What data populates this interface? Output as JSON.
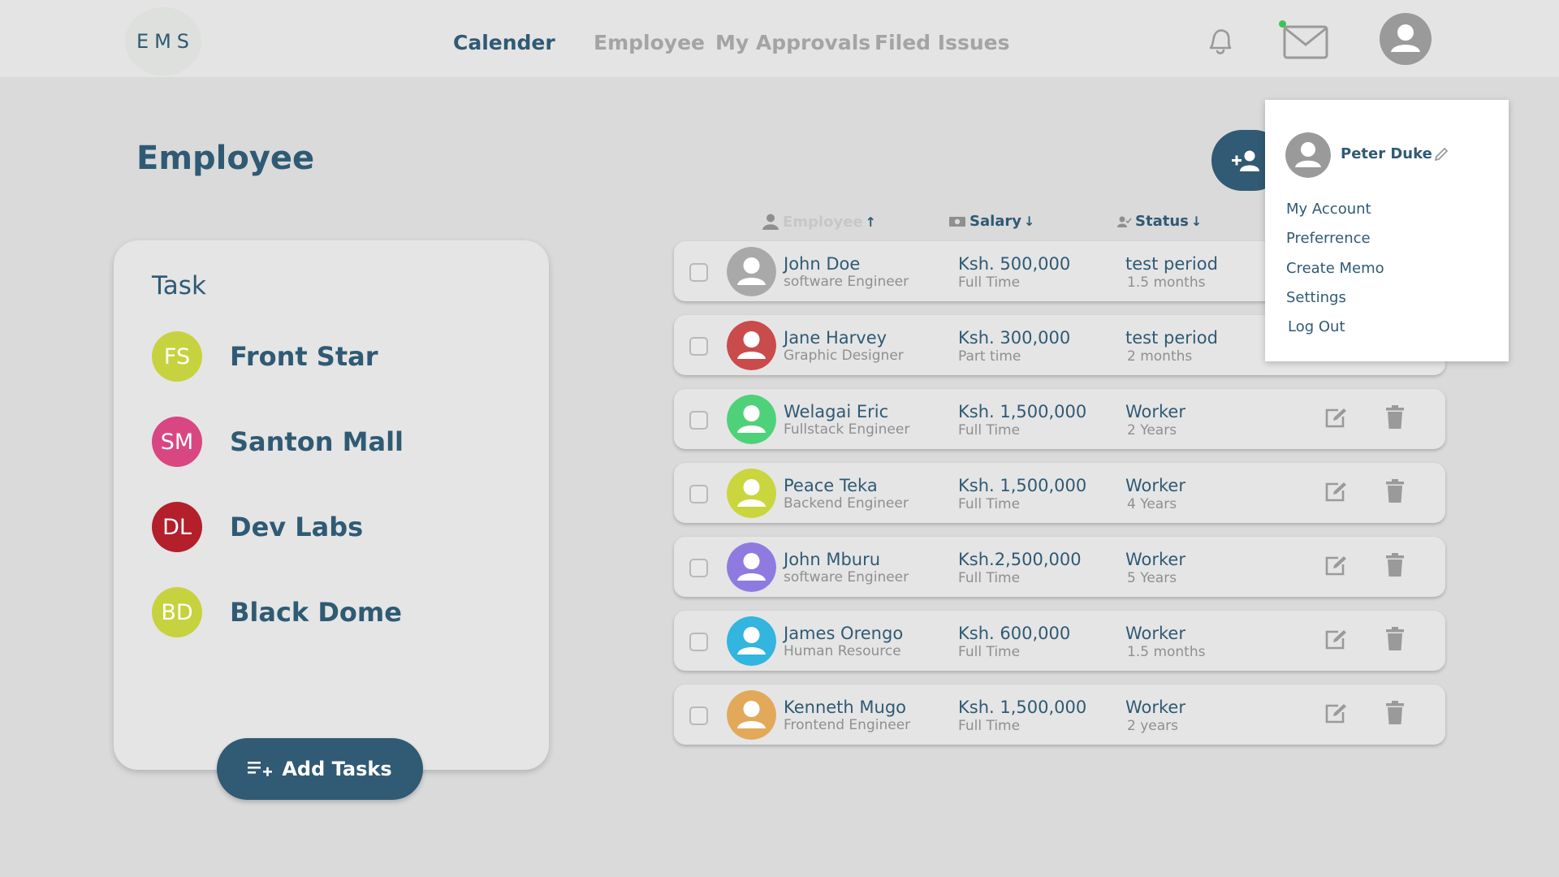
{
  "app": {
    "logo_text": "EMS"
  },
  "nav": {
    "items": [
      {
        "label": "Calender",
        "active": true
      },
      {
        "label": "Employee",
        "active": false
      },
      {
        "label": "My Approvals",
        "active": false
      },
      {
        "label": "Filed Issues",
        "active": false
      }
    ],
    "icons": [
      "bell-icon",
      "mail-icon",
      "user-avatar-icon"
    ],
    "mail_unread_indicator_color": "#3ac357"
  },
  "page": {
    "title": "Employee"
  },
  "tasks": {
    "heading": "Task",
    "items": [
      {
        "initials": "FS",
        "name": "Front Star",
        "color": "#c7d23f"
      },
      {
        "initials": "SM",
        "name": "Santon Mall",
        "color": "#d84781"
      },
      {
        "initials": "DL",
        "name": "Dev Labs",
        "color": "#b31f2b"
      },
      {
        "initials": "BD",
        "name": "Black Dome",
        "color": "#c7d23f"
      }
    ],
    "add_button_label": "Add Tasks"
  },
  "table": {
    "columns": [
      {
        "label": "Employee",
        "sort": "↑",
        "icon": "person-icon"
      },
      {
        "label": "Salary",
        "sort": "↓",
        "icon": "money-icon"
      },
      {
        "label": "Status",
        "sort": "↓",
        "icon": "person-check-icon"
      }
    ],
    "rows": [
      {
        "name": "John Doe",
        "role": "software Engineer",
        "salary": "Ksh. 500,000",
        "type": "Full Time",
        "status": "test period",
        "duration": "1.5 months",
        "avatar_color": "#a9a9a9"
      },
      {
        "name": "Jane Harvey",
        "role": "Graphic Designer",
        "salary": "Ksh. 300,000",
        "type": "Part time",
        "status": "test period",
        "duration": "2 months",
        "avatar_color": "#c94b4b"
      },
      {
        "name": "Welagai Eric",
        "role": "Fullstack Engineer",
        "salary": "Ksh. 1,500,000",
        "type": "Full Time",
        "status": "Worker",
        "duration": "2 Years",
        "avatar_color": "#4fd17a"
      },
      {
        "name": "Peace Teka",
        "role": "Backend Engineer",
        "salary": "Ksh. 1,500,000",
        "type": "Full Time",
        "status": "Worker",
        "duration": "4 Years",
        "avatar_color": "#c9d63d"
      },
      {
        "name": "John Mburu",
        "role": "software Engineer",
        "salary": "Ksh.2,500,000",
        "type": "Full Time",
        "status": "Worker",
        "duration": "5 Years",
        "avatar_color": "#8f7be0"
      },
      {
        "name": "James Orengo",
        "role": "Human Resource",
        "salary": "Ksh. 600,000",
        "type": "Full Time",
        "status": "Worker",
        "duration": "1.5 months",
        "avatar_color": "#32b5de"
      },
      {
        "name": "Kenneth Mugo",
        "role": "Frontend Engineer",
        "salary": "Ksh. 1,500,000",
        "type": "Full Time",
        "status": "Worker",
        "duration": "2 years",
        "avatar_color": "#e2a95a"
      }
    ]
  },
  "profile_menu": {
    "user_name": "Peter Duke",
    "items": [
      "My Account",
      "Preferrence",
      "Create Memo",
      "Settings",
      "Log Out"
    ]
  },
  "colors": {
    "primary": "#315a74",
    "background": "#dadada",
    "card": "#e5e5e5"
  }
}
